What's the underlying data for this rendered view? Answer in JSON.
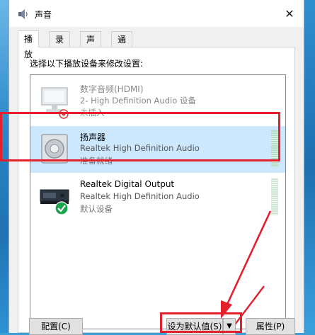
{
  "window": {
    "title": "声音",
    "close_glyph": "✕"
  },
  "tabs": [
    {
      "label": "播放",
      "active": true
    },
    {
      "label": "录制"
    },
    {
      "label": "声音"
    },
    {
      "label": "通信"
    }
  ],
  "instruction": "选择以下播放设备来修改设置:",
  "devices": [
    {
      "name": "数字音频(HDMI)",
      "description": "2- High Definition Audio 设备",
      "status": "未插入",
      "icon": "monitor-icon",
      "badge": "unplugged-badge"
    },
    {
      "name": "扬声器",
      "description": "Realtek High Definition Audio",
      "status": "准备就绪",
      "icon": "speaker-icon",
      "selected": true
    },
    {
      "name": "Realtek Digital Output",
      "description": "Realtek High Definition Audio",
      "status": "默认设备",
      "icon": "digital-output-icon",
      "badge": "default-check-badge"
    }
  ],
  "buttons": {
    "configure": "配置(C)",
    "set_default": "设为默认值(S)",
    "dropdown_glyph": "▼",
    "properties": "属性(P)"
  },
  "colors": {
    "highlight": "#e4202d",
    "selection": "#cce8ff",
    "default_check": "#1aa34a"
  }
}
